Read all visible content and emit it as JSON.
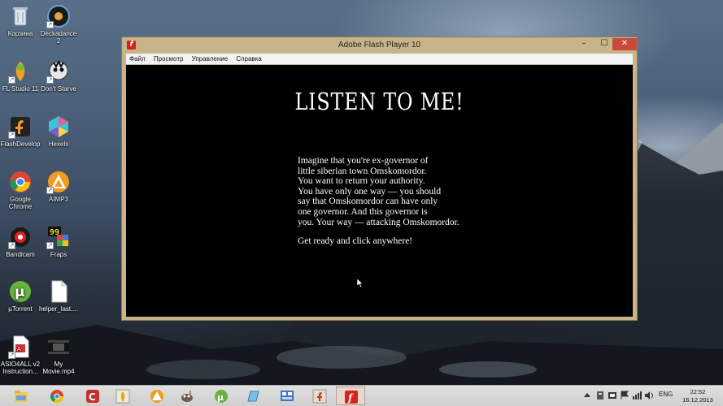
{
  "desktop": {
    "icons": [
      {
        "label": "Корзина"
      },
      {
        "label": "Deckadance 2"
      },
      {
        "label": "FL Studio 11"
      },
      {
        "label": "Don't Starve"
      },
      {
        "label": "FlashDevelop"
      },
      {
        "label": "Hexels"
      },
      {
        "label": "Google Chrome"
      },
      {
        "label": "AIMP3"
      },
      {
        "label": "Bandicam"
      },
      {
        "label": "Fraps"
      },
      {
        "label": "µTorrent"
      },
      {
        "label": "helper_last...."
      },
      {
        "label": "ASIO4ALL v2 Instruction..."
      },
      {
        "label": "My Movie.mp4"
      }
    ]
  },
  "window": {
    "title": "Adobe Flash Player 10",
    "app_icon_glyph": "f",
    "controls": {
      "minimize": "–",
      "maximize": "☐",
      "close": "✕"
    },
    "menu": [
      "Файл",
      "Просмотр",
      "Управление",
      "Справка"
    ]
  },
  "game": {
    "heading": "LISTEN TO ME!",
    "story": "Imagine that you're ex-governor of\nlittle siberian town Omskomordor.\nYou want to return your authority.\nYou have only one way — you should\nsay that Omskomordor can have only\none governor. And this governor is\nyou. Your way — attacking Omskomordor.",
    "prompt": "Get ready and click anywhere!"
  },
  "taskbar": {
    "pinned": [
      "file-explorer-icon",
      "chrome-icon",
      "cclean-icon",
      "fl-studio-icon",
      "aimp-icon",
      "gimp-icon",
      "utorrent-icon",
      "notepad-icon",
      "hexels-icon",
      "flashdevelop-icon",
      "flash-player-icon"
    ],
    "language": "ENG",
    "time": "22:52",
    "date": "16.12.2013"
  }
}
